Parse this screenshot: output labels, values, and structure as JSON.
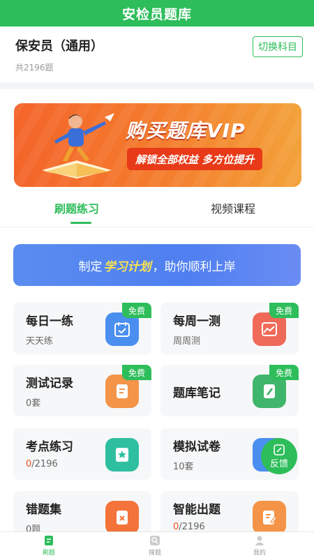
{
  "header": {
    "title": "安检员题库"
  },
  "subject": {
    "name": "保安员（通用）",
    "count": "共2196题",
    "switch_label": "切换科目"
  },
  "banner": {
    "title": "购买题库VIP",
    "subtitle": "解锁全部权益  多方位提升"
  },
  "tabs": [
    {
      "label": "刷题练习"
    },
    {
      "label": "视频课程"
    }
  ],
  "plan": {
    "prefix": "制定",
    "highlight": "学习计划",
    "suffix": "，助你顺利上岸"
  },
  "cards": [
    {
      "title": "每日一练",
      "sub": "天天练",
      "badge": "免费",
      "icon": "calendar-check-icon",
      "color": "#4a8ff0"
    },
    {
      "title": "每周一测",
      "sub": "周周测",
      "badge": "免费",
      "icon": "chart-image-icon",
      "color": "#f06a5a"
    },
    {
      "title": "测试记录",
      "sub": "0套",
      "badge": "免费",
      "icon": "document-list-icon",
      "color": "#f39448"
    },
    {
      "title": "题库笔记",
      "sub": "",
      "badge": "免费",
      "icon": "notebook-edit-icon",
      "color": "#3fb66c"
    },
    {
      "title": "考点练习",
      "sub_num": "0",
      "sub_rest": "/2196",
      "icon": "star-doc-icon",
      "color": "#2ebfa0"
    },
    {
      "title": "模拟试卷",
      "sub": "10套",
      "icon": "exam-paper-icon",
      "color": "#4a8ff0"
    },
    {
      "title": "错题集",
      "sub": "0题",
      "icon": "error-doc-icon",
      "color": "#f3733a"
    },
    {
      "title": "智能出题",
      "sub_num": "0",
      "sub_rest": "/2196",
      "icon": "edit-doc-icon",
      "color": "#f39448"
    }
  ],
  "feedback": {
    "label": "反馈"
  },
  "nav": [
    {
      "label": "刷题"
    },
    {
      "label": "搜题"
    },
    {
      "label": "我的"
    }
  ]
}
